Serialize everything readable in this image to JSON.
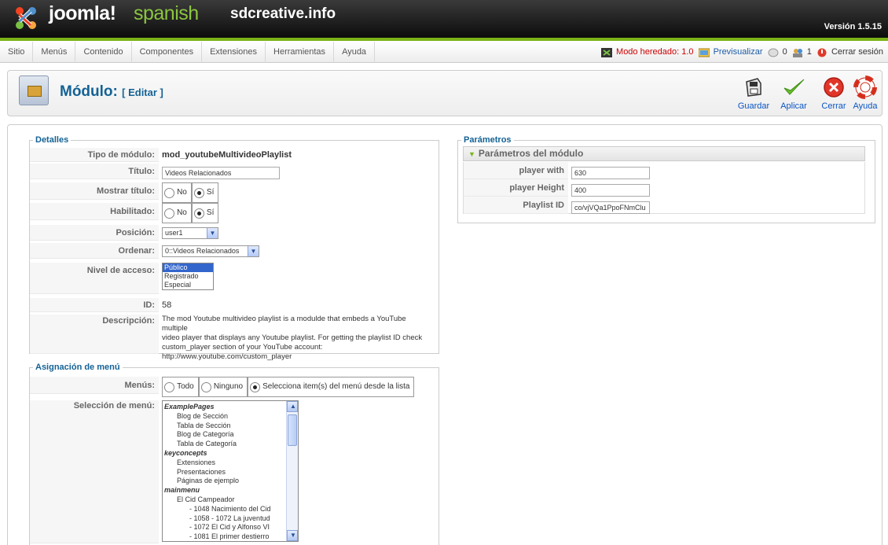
{
  "header": {
    "brand": "joomla!",
    "language": "spanish",
    "site": "sdcreative.info",
    "version": "Versión 1.5.15"
  },
  "menu": {
    "items": [
      "Sitio",
      "Menús",
      "Contenido",
      "Componentes",
      "Extensiones",
      "Herramientas",
      "Ayuda"
    ]
  },
  "status": {
    "legacy_mode": "Modo heredado: 1.0",
    "preview": "Previsualizar",
    "messages": "0",
    "users": "1",
    "logout": "Cerrar sesión"
  },
  "toolbar": {
    "title": "Módulo:",
    "subtitle": "[ Editar ]",
    "save": "Guardar",
    "apply": "Aplicar",
    "close": "Cerrar",
    "help": "Ayuda"
  },
  "details": {
    "legend": "Detalles",
    "type_label": "Tipo de módulo:",
    "type_value": "mod_youtubeMultivideoPlaylist",
    "title_label": "Título:",
    "title_value": "Videos Relacionados",
    "show_title_label": "Mostrar título:",
    "enabled_label": "Habilitado:",
    "no": "No",
    "yes": "Sí",
    "position_label": "Posición:",
    "position_value": "user1",
    "order_label": "Ordenar:",
    "order_value": "0::Videos Relacionados",
    "access_label": "Nivel de acceso:",
    "access_options": [
      "Público",
      "Registrado",
      "Especial"
    ],
    "id_label": "ID:",
    "id_value": "58",
    "description_label": "Descripción:",
    "description_lines": [
      "The mod Youtube multivideo playlist is a modulde that embeds a YouTube multiple",
      "video player that displays any Youtube playlist. For getting the playlist ID check",
      "custom_player section of your YouTube account:",
      "http://www.youtube.com/custom_player"
    ]
  },
  "menu_assignment": {
    "legend": "Asignación de menú",
    "menus_label": "Menús:",
    "opt_all": "Todo",
    "opt_none": "Ninguno",
    "opt_select": "Selecciona item(s) del menú desde la lista",
    "selection_label": "Selección de menú:",
    "tree": [
      {
        "text": "ExamplePages",
        "group": true,
        "indent": 0
      },
      {
        "text": "Blog de Sección",
        "group": false,
        "indent": 1
      },
      {
        "text": "Tabla de Sección",
        "group": false,
        "indent": 1
      },
      {
        "text": "Blog de Categoría",
        "group": false,
        "indent": 1
      },
      {
        "text": "Tabla de Categoría",
        "group": false,
        "indent": 1
      },
      {
        "text": "keyconcepts",
        "group": true,
        "indent": 0
      },
      {
        "text": "Extensiones",
        "group": false,
        "indent": 1
      },
      {
        "text": "Presentaciones",
        "group": false,
        "indent": 1
      },
      {
        "text": "Páginas de ejemplo",
        "group": false,
        "indent": 1
      },
      {
        "text": "mainmenu",
        "group": true,
        "indent": 0
      },
      {
        "text": "El Cid Campeador",
        "group": false,
        "indent": 1
      },
      {
        "text": "- 1048 Nacimiento del Cid",
        "group": false,
        "indent": 2
      },
      {
        "text": "- 1058 - 1072 La juventud",
        "group": false,
        "indent": 2
      },
      {
        "text": "- 1072 El Cid y Alfonso VI",
        "group": false,
        "indent": 2
      },
      {
        "text": "- 1081 El primer destierro",
        "group": false,
        "indent": 2
      }
    ]
  },
  "params": {
    "legend": "Parámetros",
    "section": "Parámetros del módulo",
    "width_label": "player with",
    "width_value": "630",
    "height_label": "player Height",
    "height_value": "400",
    "playlist_label": "Playlist ID",
    "playlist_value": "co/vjVQa1PpoFNmClu"
  }
}
